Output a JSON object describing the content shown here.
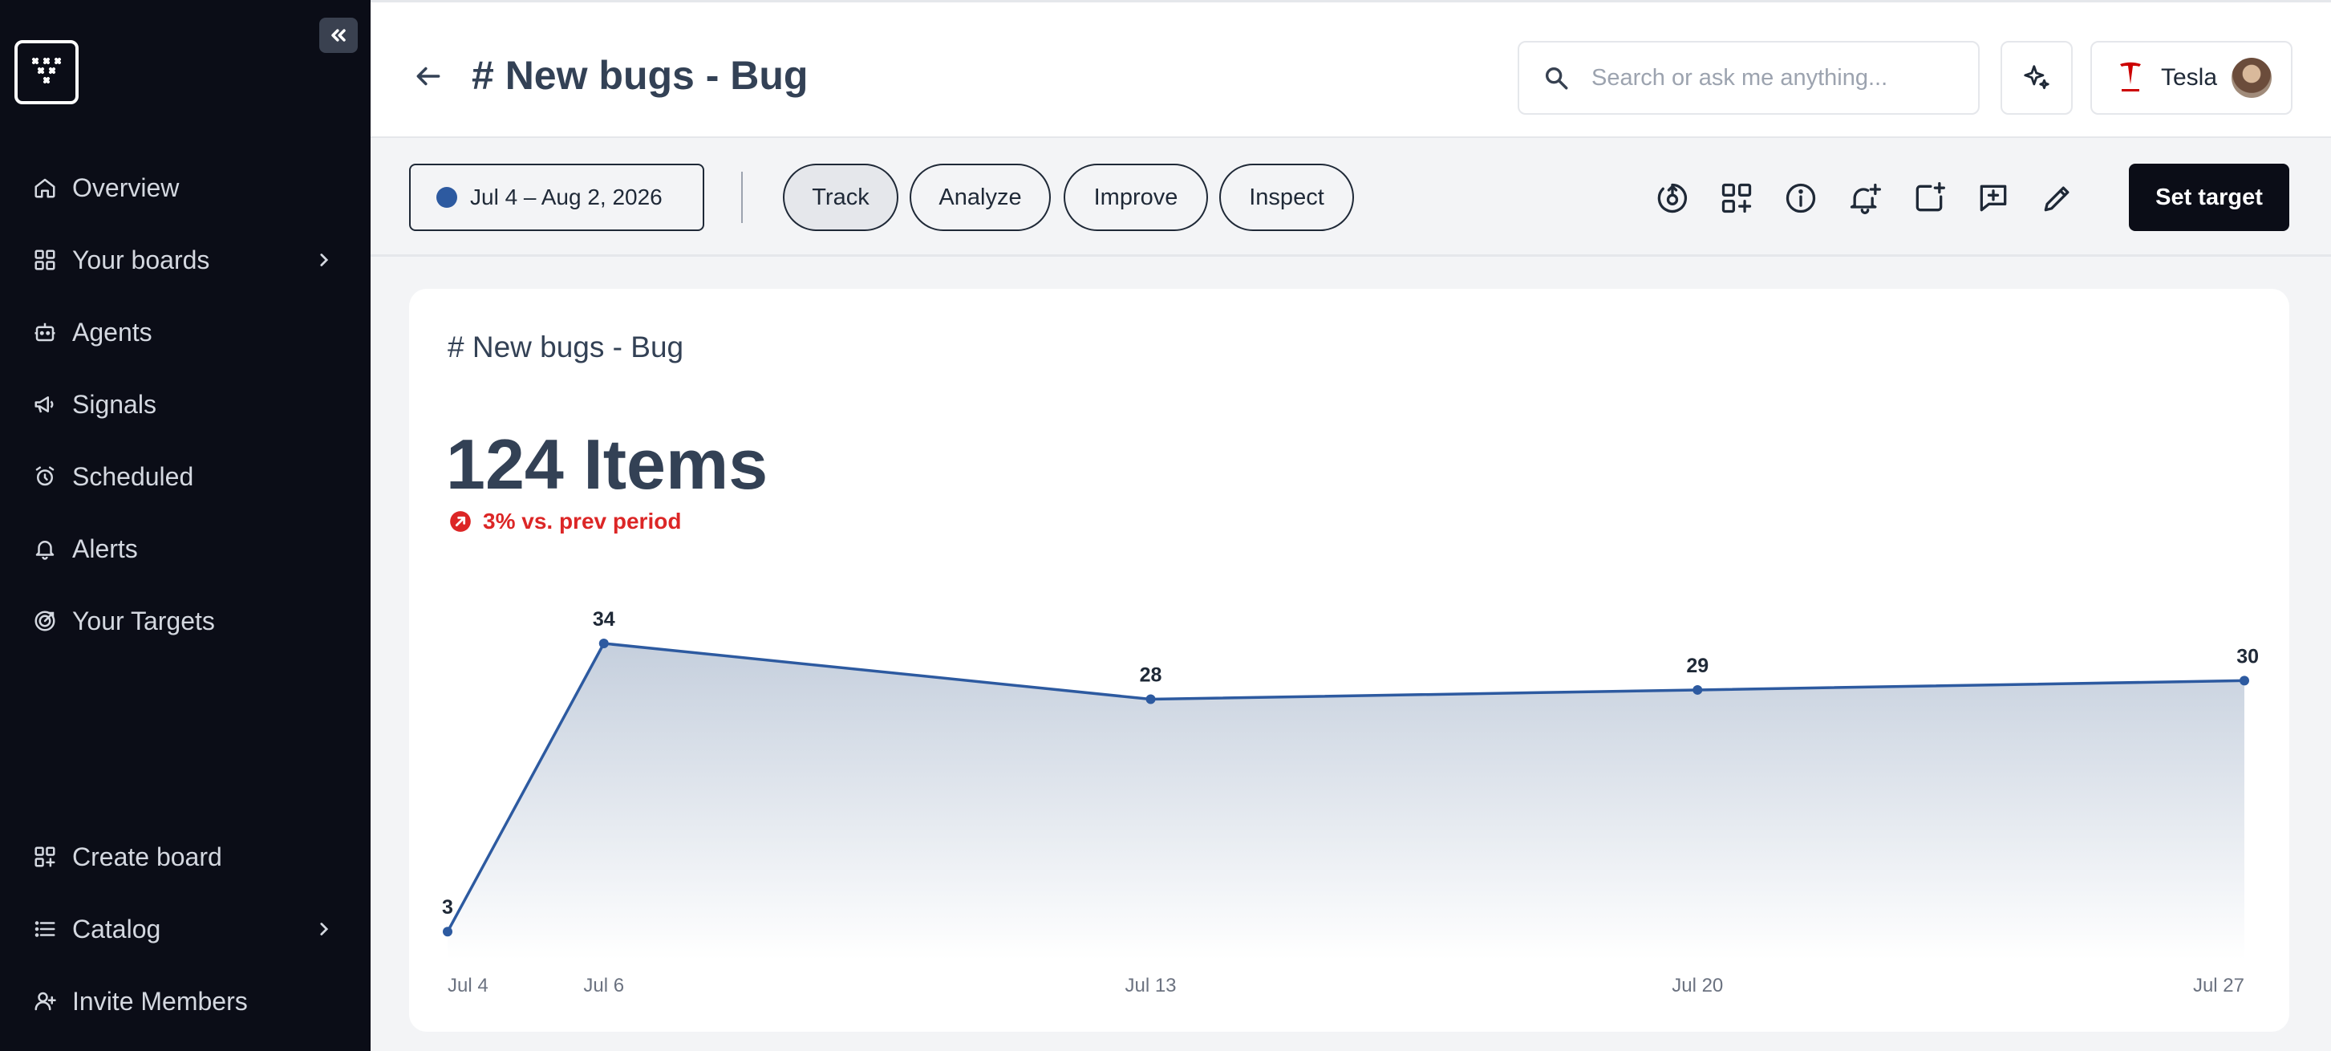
{
  "sidebar": {
    "nav_items": [
      {
        "label": "Overview",
        "icon": "home-icon"
      },
      {
        "label": "Your boards",
        "icon": "grid-icon"
      },
      {
        "label": "Agents",
        "icon": "bot-icon"
      },
      {
        "label": "Signals",
        "icon": "megaphone-icon"
      },
      {
        "label": "Scheduled",
        "icon": "alarm-clock-icon"
      },
      {
        "label": "Alerts",
        "icon": "bell-icon"
      },
      {
        "label": "Your Targets",
        "icon": "target-icon"
      }
    ],
    "bottom_items": [
      {
        "label": "Create board",
        "icon": "grid-plus-icon"
      },
      {
        "label": "Catalog",
        "icon": "list-icon"
      },
      {
        "label": "Invite Members",
        "icon": "user-plus-icon"
      }
    ]
  },
  "header": {
    "title": "# New bugs - Bug",
    "search_placeholder": "Search or ask me anything...",
    "org_name": "Tesla"
  },
  "toolbar": {
    "date_range": "Jul 4 – Aug 2, 2026",
    "tabs": [
      "Track",
      "Analyze",
      "Improve",
      "Inspect"
    ],
    "active_tab": "Track",
    "set_target_label": "Set target"
  },
  "card": {
    "title": "# New bugs - Bug",
    "metric": "124 Items",
    "delta": "3% vs. prev period"
  },
  "colors": {
    "sidebar_bg": "#0b0d17",
    "accent": "#2d5aa0",
    "negative": "#dc2626"
  },
  "chart_data": {
    "type": "area",
    "x": [
      "Jul 4",
      "Jul 6",
      "Jul 13",
      "Jul 20",
      "Jul 27"
    ],
    "series": [
      {
        "values": [
          3,
          34,
          28,
          29,
          30
        ]
      }
    ],
    "data_labels": [
      "3",
      "34",
      "28",
      "29",
      "30"
    ],
    "grid": false
  }
}
